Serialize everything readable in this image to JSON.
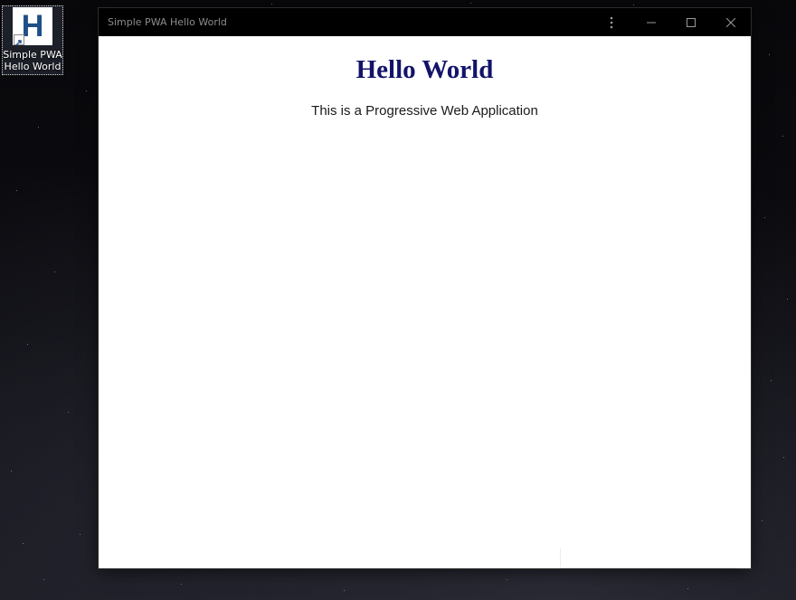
{
  "desktop": {
    "shortcut": {
      "icon_letter": "H",
      "icon_color": "#1f4f88",
      "label_line1": "Simple PWA",
      "label_line2": "Hello World"
    }
  },
  "window": {
    "title": "Simple PWA Hello World",
    "controls": {
      "menu_icon": "more-vertical-icon",
      "minimize_icon": "minimize-icon",
      "maximize_icon": "maximize-icon",
      "close_icon": "close-icon"
    },
    "titlebar_color": "#000000"
  },
  "page": {
    "heading": "Hello World",
    "heading_color": "#13136b",
    "paragraph": "This is a Progressive Web Application"
  }
}
